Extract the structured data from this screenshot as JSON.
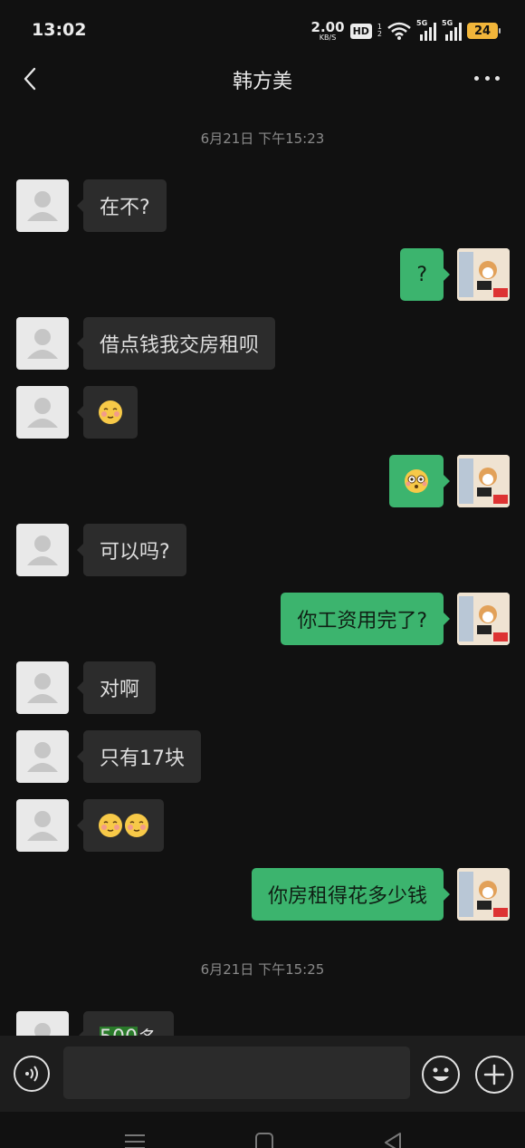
{
  "status_bar": {
    "time": "13:02",
    "net_speed": "2.00",
    "net_unit": "KB/S",
    "hd": "HD",
    "hd_sub_top": "1",
    "hd_sub_bottom": "2",
    "sig1_label": "5G",
    "sig2_label": "5G",
    "battery": "24"
  },
  "header": {
    "title": "韩方美"
  },
  "chat": {
    "timestamps": [
      "6月21日 下午15:23",
      "6月21日 下午15:25"
    ],
    "messages": [
      {
        "from": "them",
        "text": "在不?"
      },
      {
        "from": "me",
        "text": "?"
      },
      {
        "from": "them",
        "text": "借点钱我交房租呗"
      },
      {
        "from": "them",
        "emoji": "blush-emoji"
      },
      {
        "from": "me",
        "emoji": "flushed-emoji"
      },
      {
        "from": "them",
        "text": "可以吗?"
      },
      {
        "from": "me",
        "text": "你工资用完了?"
      },
      {
        "from": "them",
        "text": "对啊"
      },
      {
        "from": "them",
        "text": "只有17块"
      },
      {
        "from": "them",
        "emoji": "blush-emoji-x2"
      },
      {
        "from": "me",
        "text": "你房租得花多少钱"
      },
      {
        "from": "them",
        "text_highlight": "500",
        "text": "多"
      }
    ]
  },
  "input_bar": {
    "placeholder": "",
    "value": ""
  },
  "colors": {
    "background": "#111111",
    "bubble_in": "#2c2c2c",
    "bubble_out": "#3cb46e",
    "battery": "#f1b53a"
  }
}
